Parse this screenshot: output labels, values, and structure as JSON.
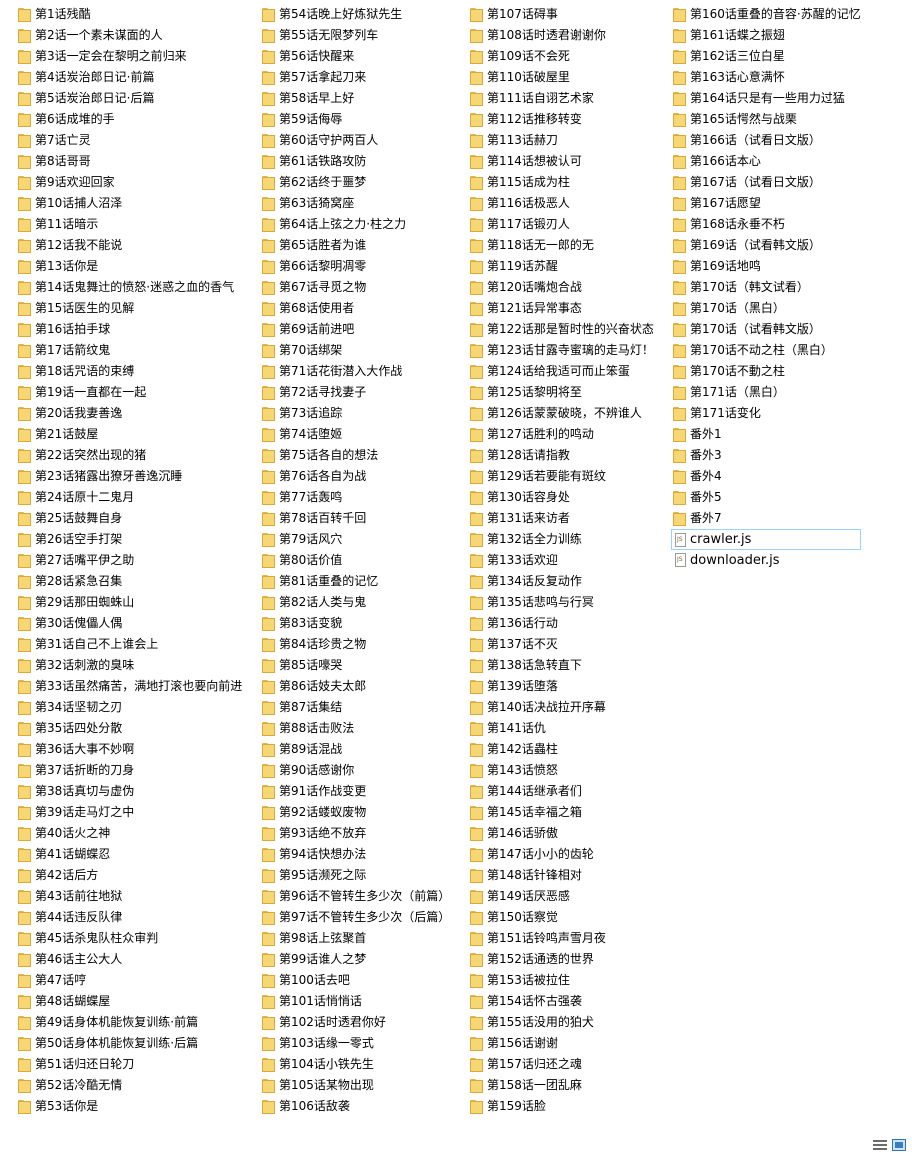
{
  "colors": {
    "folder_fill": "#f7d674",
    "folder_border": "#d9a93a",
    "selection_border": "#99d1ff"
  },
  "columns": [
    {
      "items": [
        {
          "label": "第1话残酷",
          "type": "folder"
        },
        {
          "label": "第2话一个素未谋面的人",
          "type": "folder"
        },
        {
          "label": "第3话一定会在黎明之前归来",
          "type": "folder"
        },
        {
          "label": "第4话炭治郎日记·前篇",
          "type": "folder"
        },
        {
          "label": "第5话炭治郎日记·后篇",
          "type": "folder"
        },
        {
          "label": "第6话成堆的手",
          "type": "folder"
        },
        {
          "label": "第7话亡灵",
          "type": "folder"
        },
        {
          "label": "第8话哥哥",
          "type": "folder"
        },
        {
          "label": "第9话欢迎回家",
          "type": "folder"
        },
        {
          "label": "第10话捕人沼泽",
          "type": "folder"
        },
        {
          "label": "第11话暗示",
          "type": "folder"
        },
        {
          "label": "第12话我不能说",
          "type": "folder"
        },
        {
          "label": "第13话你是",
          "type": "folder"
        },
        {
          "label": "第14话鬼舞辻的愤怒·迷惑之血的香气",
          "type": "folder"
        },
        {
          "label": "第15话医生的见解",
          "type": "folder"
        },
        {
          "label": "第16话拍手球",
          "type": "folder"
        },
        {
          "label": "第17话箭纹鬼",
          "type": "folder"
        },
        {
          "label": "第18话咒语的束缚",
          "type": "folder"
        },
        {
          "label": "第19话一直都在一起",
          "type": "folder"
        },
        {
          "label": "第20话我妻善逸",
          "type": "folder"
        },
        {
          "label": "第21话鼓屋",
          "type": "folder"
        },
        {
          "label": "第22话突然出现的猪",
          "type": "folder"
        },
        {
          "label": "第23话猪露出獠牙善逸沉睡",
          "type": "folder"
        },
        {
          "label": "第24话原十二鬼月",
          "type": "folder"
        },
        {
          "label": "第25话鼓舞自身",
          "type": "folder"
        },
        {
          "label": "第26话空手打架",
          "type": "folder"
        },
        {
          "label": "第27话嘴平伊之助",
          "type": "folder"
        },
        {
          "label": "第28话紧急召集",
          "type": "folder"
        },
        {
          "label": "第29话那田蜘蛛山",
          "type": "folder"
        },
        {
          "label": "第30话傀儡人偶",
          "type": "folder"
        },
        {
          "label": "第31话自己不上谁会上",
          "type": "folder"
        },
        {
          "label": "第32话刺激的臭味",
          "type": "folder"
        },
        {
          "label": "第33话虽然痛苦，满地打滚也要向前进",
          "type": "folder"
        },
        {
          "label": "第34话坚韧之刃",
          "type": "folder"
        },
        {
          "label": "第35话四处分散",
          "type": "folder"
        },
        {
          "label": "第36话大事不妙啊",
          "type": "folder"
        },
        {
          "label": "第37话折断的刀身",
          "type": "folder"
        },
        {
          "label": "第38话真切与虚伪",
          "type": "folder"
        },
        {
          "label": "第39话走马灯之中",
          "type": "folder"
        },
        {
          "label": "第40话火之神",
          "type": "folder"
        },
        {
          "label": "第41话蝴蝶忍",
          "type": "folder"
        },
        {
          "label": "第42话后方",
          "type": "folder"
        },
        {
          "label": "第43话前往地狱",
          "type": "folder"
        },
        {
          "label": "第44话违反队律",
          "type": "folder"
        },
        {
          "label": "第45话杀鬼队柱众审判",
          "type": "folder"
        },
        {
          "label": "第46话主公大人",
          "type": "folder"
        },
        {
          "label": "第47话哼",
          "type": "folder"
        },
        {
          "label": "第48话蝴蝶屋",
          "type": "folder"
        },
        {
          "label": "第49话身体机能恢复训练·前篇",
          "type": "folder"
        },
        {
          "label": "第50话身体机能恢复训练·后篇",
          "type": "folder"
        },
        {
          "label": "第51话归还日轮刀",
          "type": "folder"
        },
        {
          "label": "第52话冷酷无情",
          "type": "folder"
        },
        {
          "label": "第53话你是",
          "type": "folder"
        }
      ]
    },
    {
      "items": [
        {
          "label": "第54话晚上好炼狱先生",
          "type": "folder"
        },
        {
          "label": "第55话无限梦列车",
          "type": "folder"
        },
        {
          "label": "第56话快醒来",
          "type": "folder"
        },
        {
          "label": "第57话拿起刀来",
          "type": "folder"
        },
        {
          "label": "第58话早上好",
          "type": "folder"
        },
        {
          "label": "第59话侮辱",
          "type": "folder"
        },
        {
          "label": "第60话守护两百人",
          "type": "folder"
        },
        {
          "label": "第61话铁路攻防",
          "type": "folder"
        },
        {
          "label": "第62话终于噩梦",
          "type": "folder"
        },
        {
          "label": "第63话猗窝座",
          "type": "folder"
        },
        {
          "label": "第64话上弦之力·柱之力",
          "type": "folder"
        },
        {
          "label": "第65话胜者为谁",
          "type": "folder"
        },
        {
          "label": "第66话黎明凋零",
          "type": "folder"
        },
        {
          "label": "第67话寻觅之物",
          "type": "folder"
        },
        {
          "label": "第68话使用者",
          "type": "folder"
        },
        {
          "label": "第69话前进吧",
          "type": "folder"
        },
        {
          "label": "第70话绑架",
          "type": "folder"
        },
        {
          "label": "第71话花街潜入大作战",
          "type": "folder"
        },
        {
          "label": "第72话寻找妻子",
          "type": "folder"
        },
        {
          "label": "第73话追踪",
          "type": "folder"
        },
        {
          "label": "第74话堕姬",
          "type": "folder"
        },
        {
          "label": "第75话各自的想法",
          "type": "folder"
        },
        {
          "label": "第76话各自为战",
          "type": "folder"
        },
        {
          "label": "第77话轰鸣",
          "type": "folder"
        },
        {
          "label": "第78话百转千回",
          "type": "folder"
        },
        {
          "label": "第79话风穴",
          "type": "folder"
        },
        {
          "label": "第80话价值",
          "type": "folder"
        },
        {
          "label": "第81话重叠的记忆",
          "type": "folder"
        },
        {
          "label": "第82话人类与鬼",
          "type": "folder"
        },
        {
          "label": "第83话变貌",
          "type": "folder"
        },
        {
          "label": "第84话珍贵之物",
          "type": "folder"
        },
        {
          "label": "第85话嚎哭",
          "type": "folder"
        },
        {
          "label": "第86话妓夫太郎",
          "type": "folder"
        },
        {
          "label": "第87话集结",
          "type": "folder"
        },
        {
          "label": "第88话击败法",
          "type": "folder"
        },
        {
          "label": "第89话混战",
          "type": "folder"
        },
        {
          "label": "第90话感谢你",
          "type": "folder"
        },
        {
          "label": "第91话作战变更",
          "type": "folder"
        },
        {
          "label": "第92话蝼蚁废物",
          "type": "folder"
        },
        {
          "label": "第93话绝不放弃",
          "type": "folder"
        },
        {
          "label": "第94话快想办法",
          "type": "folder"
        },
        {
          "label": "第95话濒死之际",
          "type": "folder"
        },
        {
          "label": "第96话不管转生多少次（前篇）",
          "type": "folder"
        },
        {
          "label": "第97话不管转生多少次（后篇）",
          "type": "folder"
        },
        {
          "label": "第98话上弦聚首",
          "type": "folder"
        },
        {
          "label": "第99话谁人之梦",
          "type": "folder"
        },
        {
          "label": "第100话去吧",
          "type": "folder"
        },
        {
          "label": "第101话悄悄话",
          "type": "folder"
        },
        {
          "label": "第102话时透君你好",
          "type": "folder"
        },
        {
          "label": "第103话缘一零式",
          "type": "folder"
        },
        {
          "label": "第104话小铁先生",
          "type": "folder"
        },
        {
          "label": "第105话某物出现",
          "type": "folder"
        },
        {
          "label": "第106话敌袭",
          "type": "folder"
        }
      ]
    },
    {
      "items": [
        {
          "label": "第107话碍事",
          "type": "folder"
        },
        {
          "label": "第108话时透君谢谢你",
          "type": "folder"
        },
        {
          "label": "第109话不会死",
          "type": "folder"
        },
        {
          "label": "第110话破屋里",
          "type": "folder"
        },
        {
          "label": "第111话自诩艺术家",
          "type": "folder"
        },
        {
          "label": "第112话推移转变",
          "type": "folder"
        },
        {
          "label": "第113话赫刀",
          "type": "folder"
        },
        {
          "label": "第114话想被认可",
          "type": "folder"
        },
        {
          "label": "第115话成为柱",
          "type": "folder"
        },
        {
          "label": "第116话极恶人",
          "type": "folder"
        },
        {
          "label": "第117话锻刃人",
          "type": "folder"
        },
        {
          "label": "第118话无一郎的无",
          "type": "folder"
        },
        {
          "label": "第119话苏醒",
          "type": "folder"
        },
        {
          "label": "第120话嘴炮合战",
          "type": "folder"
        },
        {
          "label": "第121话异常事态",
          "type": "folder"
        },
        {
          "label": "第122话那是暂时性的兴奋状态",
          "type": "folder"
        },
        {
          "label": "第123话甘露寺蜜璃的走马灯！",
          "type": "folder"
        },
        {
          "label": "第124话给我适可而止笨蛋",
          "type": "folder"
        },
        {
          "label": "第125话黎明将至",
          "type": "folder"
        },
        {
          "label": "第126话蒙蒙破晓，不辨谁人",
          "type": "folder"
        },
        {
          "label": "第127话胜利的鸣动",
          "type": "folder"
        },
        {
          "label": "第128话请指教",
          "type": "folder"
        },
        {
          "label": "第129话若要能有斑纹",
          "type": "folder"
        },
        {
          "label": "第130话容身处",
          "type": "folder"
        },
        {
          "label": "第131话来访者",
          "type": "folder"
        },
        {
          "label": "第132话全力训练",
          "type": "folder"
        },
        {
          "label": "第133话欢迎",
          "type": "folder"
        },
        {
          "label": "第134话反复动作",
          "type": "folder"
        },
        {
          "label": "第135话悲鸣与行冥",
          "type": "folder"
        },
        {
          "label": "第136话行动",
          "type": "folder"
        },
        {
          "label": "第137话不灭",
          "type": "folder"
        },
        {
          "label": "第138话急转直下",
          "type": "folder"
        },
        {
          "label": "第139话堕落",
          "type": "folder"
        },
        {
          "label": "第140话决战拉开序幕",
          "type": "folder"
        },
        {
          "label": "第141话仇",
          "type": "folder"
        },
        {
          "label": "第142话蟲柱",
          "type": "folder"
        },
        {
          "label": "第143话愤怒",
          "type": "folder"
        },
        {
          "label": "第144话继承者们",
          "type": "folder"
        },
        {
          "label": "第145话幸福之箱",
          "type": "folder"
        },
        {
          "label": "第146话骄傲",
          "type": "folder"
        },
        {
          "label": "第147话小小的齿轮",
          "type": "folder"
        },
        {
          "label": "第148话针锋相对",
          "type": "folder"
        },
        {
          "label": "第149话厌恶感",
          "type": "folder"
        },
        {
          "label": "第150话察觉",
          "type": "folder"
        },
        {
          "label": "第151话铃鸣声雪月夜",
          "type": "folder"
        },
        {
          "label": "第152话通透的世界",
          "type": "folder"
        },
        {
          "label": "第153话被拉住",
          "type": "folder"
        },
        {
          "label": "第154话怀古强袭",
          "type": "folder"
        },
        {
          "label": "第155话没用的狛犬",
          "type": "folder"
        },
        {
          "label": "第156话谢谢",
          "type": "folder"
        },
        {
          "label": "第157话归还之魂",
          "type": "folder"
        },
        {
          "label": "第158话一团乱麻",
          "type": "folder"
        },
        {
          "label": "第159话脸",
          "type": "folder"
        }
      ]
    },
    {
      "items": [
        {
          "label": "第160话重叠的音容·苏醒的记忆",
          "type": "folder"
        },
        {
          "label": "第161话蝶之振翅",
          "type": "folder"
        },
        {
          "label": "第162话三位白星",
          "type": "folder"
        },
        {
          "label": "第163话心意满怀",
          "type": "folder"
        },
        {
          "label": "第164话只是有一些用力过猛",
          "type": "folder"
        },
        {
          "label": "第165话愕然与战栗",
          "type": "folder"
        },
        {
          "label": "第166话（试看日文版）",
          "type": "folder"
        },
        {
          "label": "第166话本心",
          "type": "folder"
        },
        {
          "label": "第167话（试看日文版）",
          "type": "folder"
        },
        {
          "label": "第167话愿望",
          "type": "folder"
        },
        {
          "label": "第168话永垂不朽",
          "type": "folder"
        },
        {
          "label": "第169话（试看韩文版）",
          "type": "folder"
        },
        {
          "label": "第169话地鸣",
          "type": "folder"
        },
        {
          "label": "第170话（韩文试看）",
          "type": "folder"
        },
        {
          "label": "第170话（黑白）",
          "type": "folder"
        },
        {
          "label": "第170话（试看韩文版）",
          "type": "folder"
        },
        {
          "label": "第170话不动之柱（黑白）",
          "type": "folder"
        },
        {
          "label": "第170话不動之柱",
          "type": "folder"
        },
        {
          "label": "第171话（黑白）",
          "type": "folder"
        },
        {
          "label": "第171话变化",
          "type": "folder"
        },
        {
          "label": "番外1",
          "type": "folder"
        },
        {
          "label": "番外3",
          "type": "folder"
        },
        {
          "label": "番外4",
          "type": "folder"
        },
        {
          "label": "番外5",
          "type": "folder"
        },
        {
          "label": "番外7",
          "type": "folder"
        },
        {
          "label": "crawler.js",
          "type": "file",
          "selected": true
        },
        {
          "label": "downloader.js",
          "type": "file"
        }
      ]
    }
  ],
  "view_controls": {
    "details_icon": "details-view-icon",
    "tiles_icon": "large-icons-view-icon"
  }
}
